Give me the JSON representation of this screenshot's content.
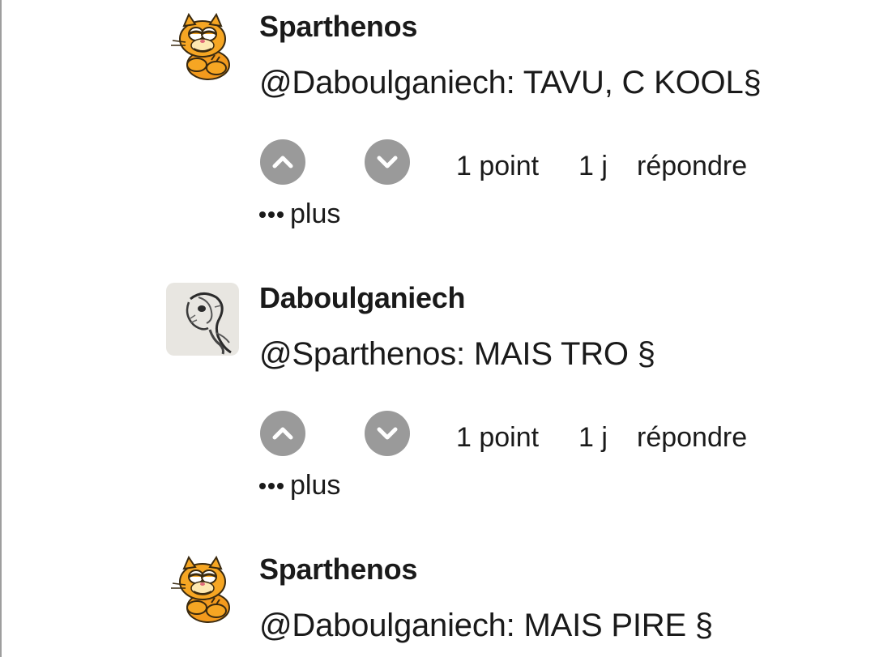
{
  "comments": [
    {
      "avatar_icon": "garfield-avatar-icon",
      "author": "Sparthenos",
      "text": "@Daboulganiech: TAVU, C KOOL§",
      "points": "1 point",
      "age": "1 j",
      "reply_label": "répondre",
      "more_label": "plus"
    },
    {
      "avatar_icon": "sketch-avatar-icon",
      "author": "Daboulganiech",
      "text": "@Sparthenos: MAIS TRO §",
      "points": "1 point",
      "age": "1 j",
      "reply_label": "répondre",
      "more_label": "plus"
    },
    {
      "avatar_icon": "garfield-avatar-icon",
      "author": "Sparthenos",
      "text": "@Daboulganiech: MAIS PIRE §"
    }
  ],
  "colors": {
    "vote_button_bg": "#9a9a9a",
    "text": "#1a1a1a",
    "background": "#ffffff"
  }
}
